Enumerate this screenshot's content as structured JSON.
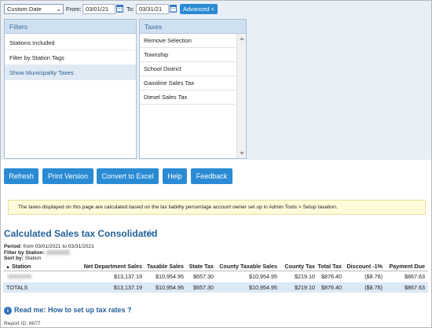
{
  "filter_bar": {
    "date_range": "Custom Date",
    "from_label": "From:",
    "from_value": "03/01/21",
    "to_label": "To:",
    "to_value": "03/31/21",
    "advanced_label": "Advanced <"
  },
  "filters_panel": {
    "title": "Filters",
    "items": [
      "Stations Included",
      "Filter by Station Tags",
      "Show Municipality Taxes"
    ],
    "selected": "Show Municipality Taxes"
  },
  "taxes_panel": {
    "title": "Taxes",
    "items": [
      "Remove Selection",
      "Township",
      "School District",
      "Gasoline Sales Tax",
      "Diesel Sales Tax"
    ]
  },
  "buttons": {
    "refresh": "Refresh",
    "print": "Print Version",
    "excel": "Convert to Excel",
    "help": "Help",
    "feedback": "Feedback"
  },
  "notice": "The taxes displayed on this page are calculated based on the tax liability percentage account owner set up in Admin Tools > Setup taxation.",
  "report": {
    "title": "Calculated Sales tax Consolidated",
    "period_label": "Period:",
    "period_value": "from 03/01/2021 to 03/31/2021",
    "filter_label": "Filter by Station:",
    "sort_label": "Sort by:",
    "sort_value": "Station"
  },
  "table": {
    "headers": [
      "Station",
      "Net Department Sales",
      "Taxable Sales",
      "State Tax",
      "County Taxable Sales",
      "County Tax",
      "Total Tax",
      "Discount -1%",
      "Payment Due"
    ],
    "row": [
      "",
      "$13,137.19",
      "$10,954.95",
      "$657.30",
      "$10,954.95",
      "$219.10",
      "$876.40",
      "($8.76)",
      "$867.63"
    ],
    "totals": [
      "TOTALS",
      "$13,137.19",
      "$10,954.95",
      "$657.30",
      "$10,954.95",
      "$219.10",
      "$876.40",
      "($8.76)",
      "$867.63"
    ]
  },
  "readme": "Read me: How to set up tax rates ?",
  "report_id": "Report ID: 8677",
  "colors": {
    "accent": "#2a8bd4",
    "title": "#26629b",
    "panel_header": "#cfe0f0",
    "notice_bg": "#fdfbd9",
    "totals_bg": "#dbe9f6"
  }
}
